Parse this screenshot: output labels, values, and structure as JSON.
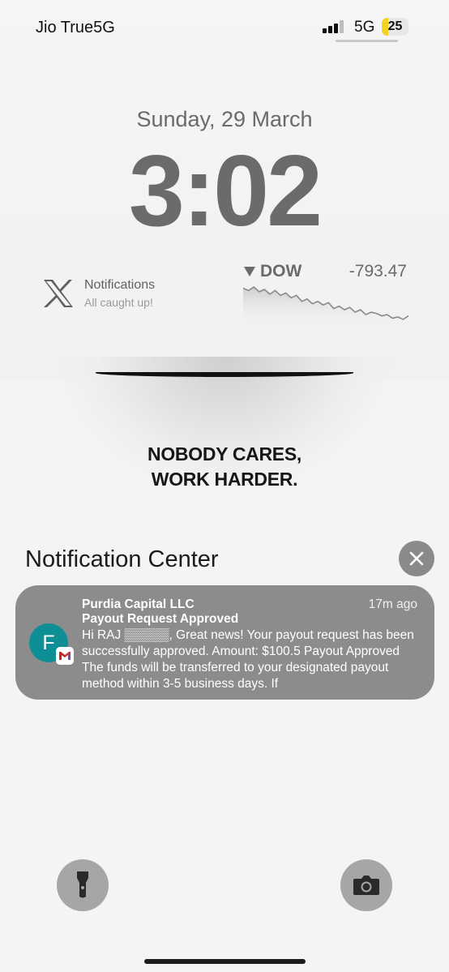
{
  "status_bar": {
    "carrier": "Jio True5G",
    "network": "5G",
    "battery_percent": "25",
    "battery_level": 0.25,
    "signal_bars": 3,
    "signal_bars_total": 4
  },
  "lock_screen": {
    "date": "Sunday, 29 March",
    "time": "3:02"
  },
  "widgets": {
    "x_notifications": {
      "icon": "x-logo-icon",
      "title": "Notifications",
      "subtitle": "All caught up!"
    },
    "stocks": {
      "symbol": "DOW",
      "change": "-793.47",
      "direction": "down",
      "trend": [
        10,
        12,
        9,
        13,
        11,
        15,
        12,
        16,
        14,
        18,
        16,
        21,
        19,
        23,
        21,
        24,
        22,
        27,
        25,
        28,
        26,
        30,
        28,
        32,
        30,
        31,
        33,
        32,
        35,
        34,
        36,
        33
      ]
    }
  },
  "wallpaper": {
    "quote_line1": "NOBODY CARES,",
    "quote_line2": "WORK HARDER."
  },
  "notification_center": {
    "title": "Notification Center",
    "close_icon": "close-icon",
    "notifications": [
      {
        "avatar_letter": "F",
        "avatar_color": "#0e8f96",
        "app_badge_icon": "gmail-icon",
        "sender": "Purdia Capital LLC",
        "time": "17m ago",
        "subject": "Payout Request Approved",
        "body": "Hi RAJ ▒▒▒▒▒, Great news! Your payout request has been successfully approved. Amount: $100.5 Payout Approved The funds will be transferred to your designated payout method within 3-5 business days. If"
      }
    ]
  },
  "bottom_controls": {
    "left_icon": "flashlight-icon",
    "right_icon": "camera-icon"
  }
}
